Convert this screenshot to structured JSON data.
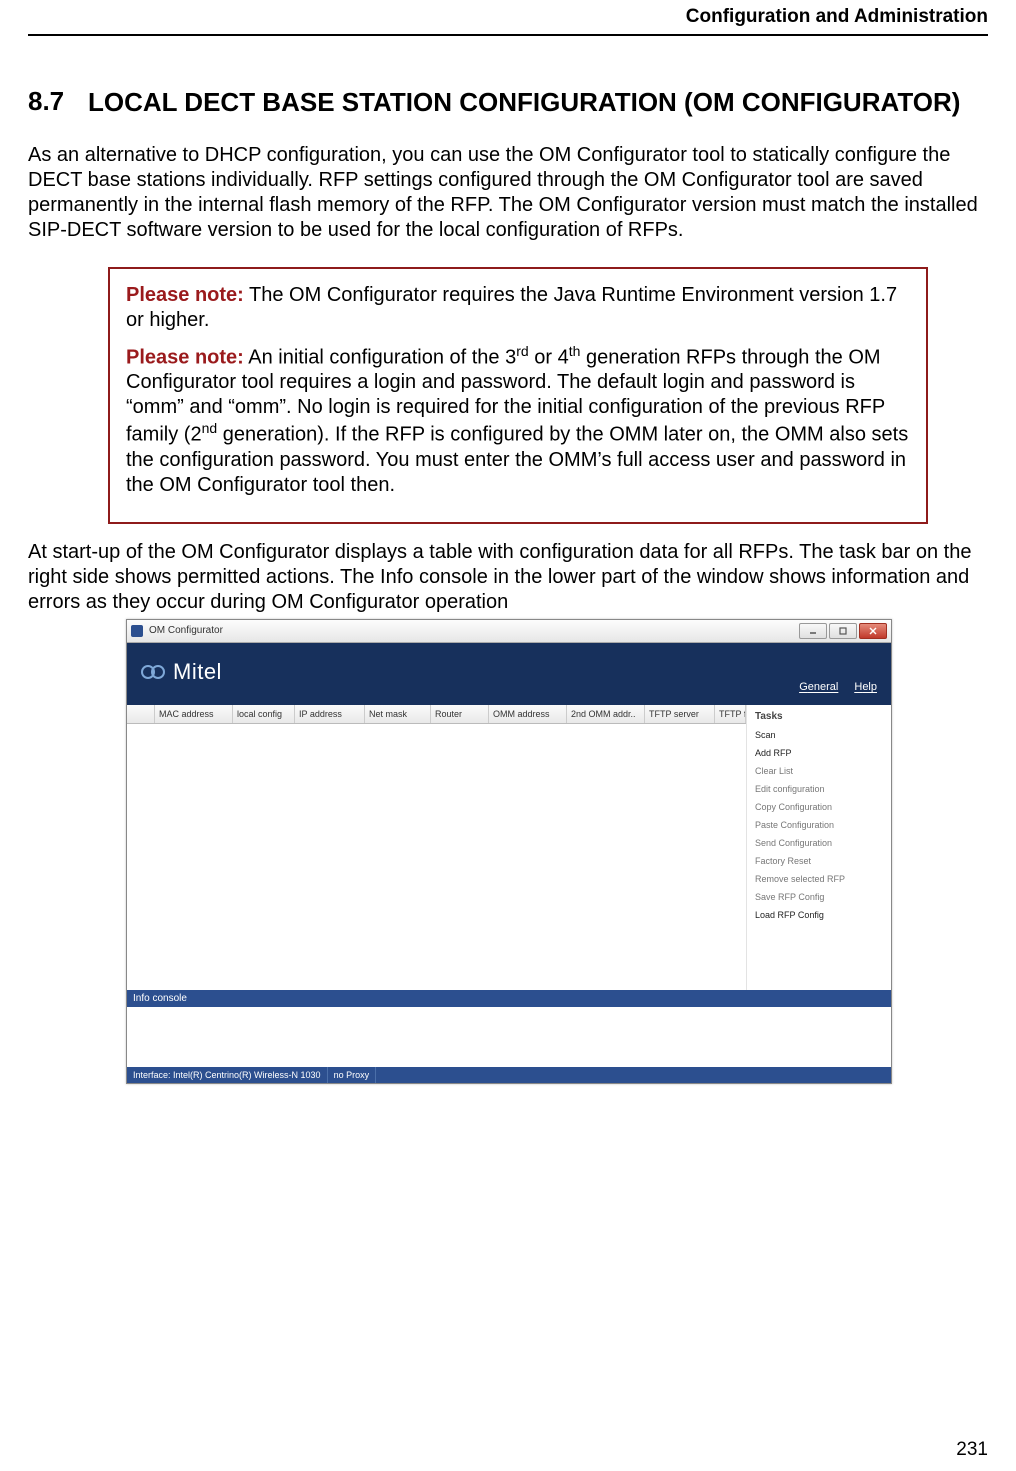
{
  "header": {
    "running_title": "Configuration and Administration"
  },
  "section": {
    "number": "8.7",
    "title": "LOCAL DECT BASE STATION CONFIGURATION (OM CONFIGURATOR)"
  },
  "paras": {
    "intro": "As an alternative to DHCP configuration, you can use the OM Configurator tool to statically configure the DECT base stations individually. RFP settings configured through the OM Configurator tool are saved permanently in the internal flash memory of the RFP. The OM Configurator version must match the installed SIP-DECT software version to be used for the local configuration of RFPs.",
    "after_note": "At start-up of the OM Configurator displays a table with configuration data for all RFPs. The task bar on the right side shows permitted actions. The Info console in the lower part of the window shows information and errors as they occur during OM Configurator operation"
  },
  "notes": {
    "label": "Please note:",
    "n1_body": " The OM Configurator requires the Java Runtime Environment version 1.7 or higher.",
    "n2_pre": " An initial configuration of the 3",
    "n2_sup1": "rd",
    "n2_mid1": " or 4",
    "n2_sup2": "th",
    "n2_mid2": " generation RFPs through the OM Configurator tool requires a login and password. The default login and password is “omm” and “omm”. No login is required for the initial configuration of the previous RFP family (2",
    "n2_sup3": "nd",
    "n2_post": " generation). If the RFP is configured by the OMM later on, the OMM also sets the configuration password. You must enter the OMM’s full access user and password in the OM Configurator tool then."
  },
  "app": {
    "window_title": "OM Configurator",
    "brand": "Mitel",
    "menus": {
      "general": "General",
      "help": "Help"
    },
    "columns": {
      "c0": "",
      "c1": "MAC address",
      "c2": "local config",
      "c3": "IP address",
      "c4": "Net mask",
      "c5": "Router",
      "c6": "OMM address",
      "c7": "2nd OMM addr..",
      "c8": "TFTP server",
      "c9": "TFTP file name"
    },
    "tasks": {
      "title": "Tasks",
      "items": {
        "t0": "Scan",
        "t1": "Add RFP",
        "t2": "Clear List",
        "t3": "Edit configuration",
        "t4": "Copy Configuration",
        "t5": "Paste Configuration",
        "t6": "Send Configuration",
        "t7": "Factory Reset",
        "t8": "Remove selected RFP",
        "t9": "Save RFP Config",
        "t10": "Load RFP Config"
      }
    },
    "info_label": "Info console",
    "status": {
      "iface": "Interface: Intel(R) Centrino(R) Wireless-N 1030",
      "proxy": "no Proxy"
    }
  },
  "page_number": "231"
}
